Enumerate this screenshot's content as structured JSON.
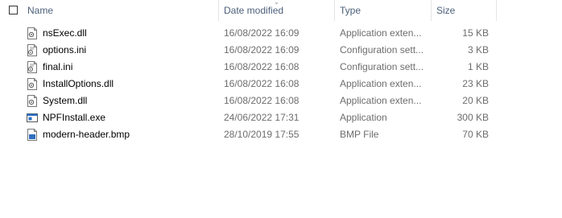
{
  "header": {
    "name": "Name",
    "date_modified": "Date modified",
    "type": "Type",
    "size": "Size"
  },
  "files": [
    {
      "name": "nsExec.dll",
      "date": "16/08/2022 16:09",
      "type": "Application exten...",
      "size": "15 KB",
      "icon": "dll-file-icon"
    },
    {
      "name": "options.ini",
      "date": "16/08/2022 16:09",
      "type": "Configuration sett...",
      "size": "3 KB",
      "icon": "ini-file-icon"
    },
    {
      "name": "final.ini",
      "date": "16/08/2022 16:08",
      "type": "Configuration sett...",
      "size": "1 KB",
      "icon": "ini-file-icon"
    },
    {
      "name": "InstallOptions.dll",
      "date": "16/08/2022 16:08",
      "type": "Application exten...",
      "size": "23 KB",
      "icon": "dll-file-icon"
    },
    {
      "name": "System.dll",
      "date": "16/08/2022 16:08",
      "type": "Application exten...",
      "size": "20 KB",
      "icon": "dll-file-icon"
    },
    {
      "name": "NPFInstall.exe",
      "date": "24/06/2022 17:31",
      "type": "Application",
      "size": "300 KB",
      "icon": "exe-file-icon"
    },
    {
      "name": "modern-header.bmp",
      "date": "28/10/2019 17:55",
      "type": "BMP File",
      "size": "70 KB",
      "icon": "bmp-file-icon"
    }
  ]
}
